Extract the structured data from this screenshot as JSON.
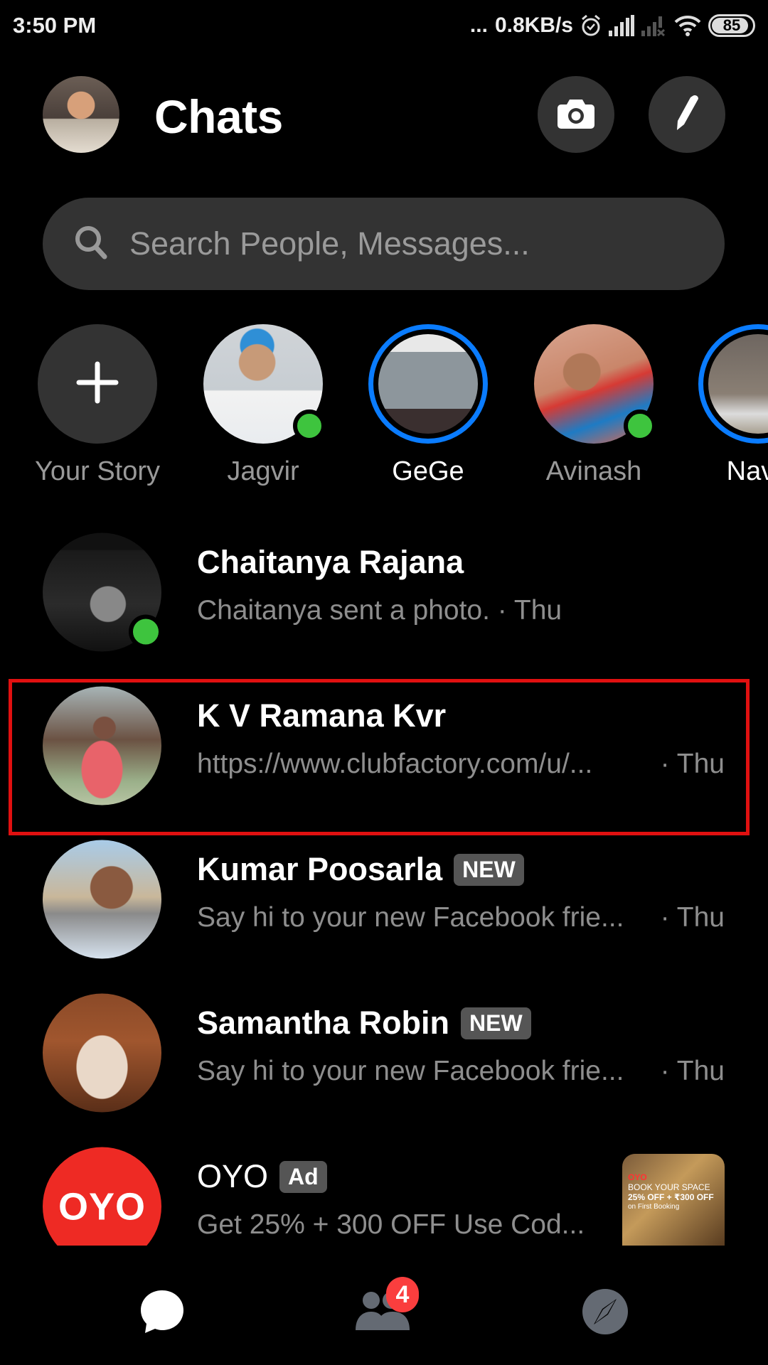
{
  "status_bar": {
    "time": "3:50 PM",
    "dots": "...",
    "network_speed": "0.8KB/s",
    "battery_level": 85,
    "icons": [
      "alarm-icon",
      "signal-icon",
      "signal-no-sim-icon",
      "wifi-icon",
      "battery-icon"
    ]
  },
  "header": {
    "title": "Chats",
    "actions": [
      "camera-icon",
      "compose-pencil-icon"
    ]
  },
  "search": {
    "placeholder": "Search People, Messages..."
  },
  "stories": [
    {
      "label": "Your Story",
      "type": "add",
      "unseen": false,
      "online": false
    },
    {
      "label": "Jagvir",
      "unseen": false,
      "online": true
    },
    {
      "label": "GeGe",
      "unseen": true,
      "online": false
    },
    {
      "label": "Avinash",
      "unseen": false,
      "online": true
    },
    {
      "label": "Nave",
      "unseen": true,
      "online": false
    }
  ],
  "chats": [
    {
      "name": "Chaitanya Rajana",
      "snippet": "Chaitanya sent a photo. · Thu",
      "time": "",
      "badge": "",
      "online": true
    },
    {
      "name": "K V Ramana Kvr",
      "snippet": "https://www.clubfactory.com/u/...",
      "time": "· Thu",
      "badge": "",
      "online": false,
      "highlighted": true
    },
    {
      "name": "Kumar Poosarla",
      "snippet": "Say hi to your new Facebook frie...",
      "time": "· Thu",
      "badge": "NEW",
      "online": false
    },
    {
      "name": "Samantha Robin",
      "snippet": "Say hi to your new Facebook frie...",
      "time": "· Thu",
      "badge": "NEW",
      "online": false
    },
    {
      "name": "OYO",
      "snippet": "Get 25% + 300 OFF Use Cod...",
      "time": "",
      "badge": "Ad",
      "online": false,
      "logo_text": "OYO",
      "ad_image_text": [
        "OYO",
        "BOOK YOUR SPACE",
        "25% OFF + ₹300 OFF",
        "on First Booking"
      ]
    }
  ],
  "bottom_nav": {
    "items": [
      {
        "name": "chats-icon",
        "active": true,
        "badge": ""
      },
      {
        "name": "people-icon",
        "active": false,
        "badge": "4"
      },
      {
        "name": "discover-compass-icon",
        "active": false,
        "badge": ""
      }
    ]
  },
  "colors": {
    "accent_blue": "#0a7cff",
    "online_green": "#3ec43e",
    "badge_red": "#fa3e3e",
    "highlight_red": "#e01010",
    "surface": "#333333"
  }
}
